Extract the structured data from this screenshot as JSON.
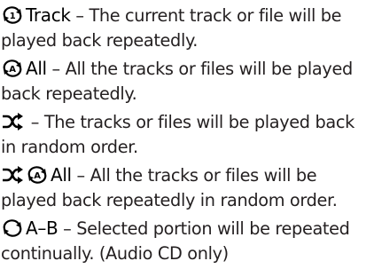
{
  "entries": [
    {
      "icon": "repeat-one-icon",
      "term": "Track",
      "line1": " – The current track or file will be",
      "line2": "played back repeatedly."
    },
    {
      "icon": "repeat-all-icon",
      "term": "All",
      "line1": " – All the tracks or files will be played",
      "line2": "back repeatedly."
    },
    {
      "icon": "shuffle-icon",
      "term": "",
      "line1": " – The tracks or files will be played back",
      "line2": "in random order."
    },
    {
      "icon": "shuffle-repeat-all-icon",
      "term": "All",
      "line1": " – All the tracks or files will be",
      "line2": "played back repeatedly in random order."
    },
    {
      "icon": "repeat-ab-icon",
      "term": "A–B",
      "line1": " – Selected portion will be repeated",
      "line2": "continually. (Audio CD only)"
    }
  ],
  "icon_badges": {
    "repeat_one": "1",
    "repeat_all": "A"
  },
  "colors": {
    "text": "#231f20",
    "icon": "#000000"
  }
}
